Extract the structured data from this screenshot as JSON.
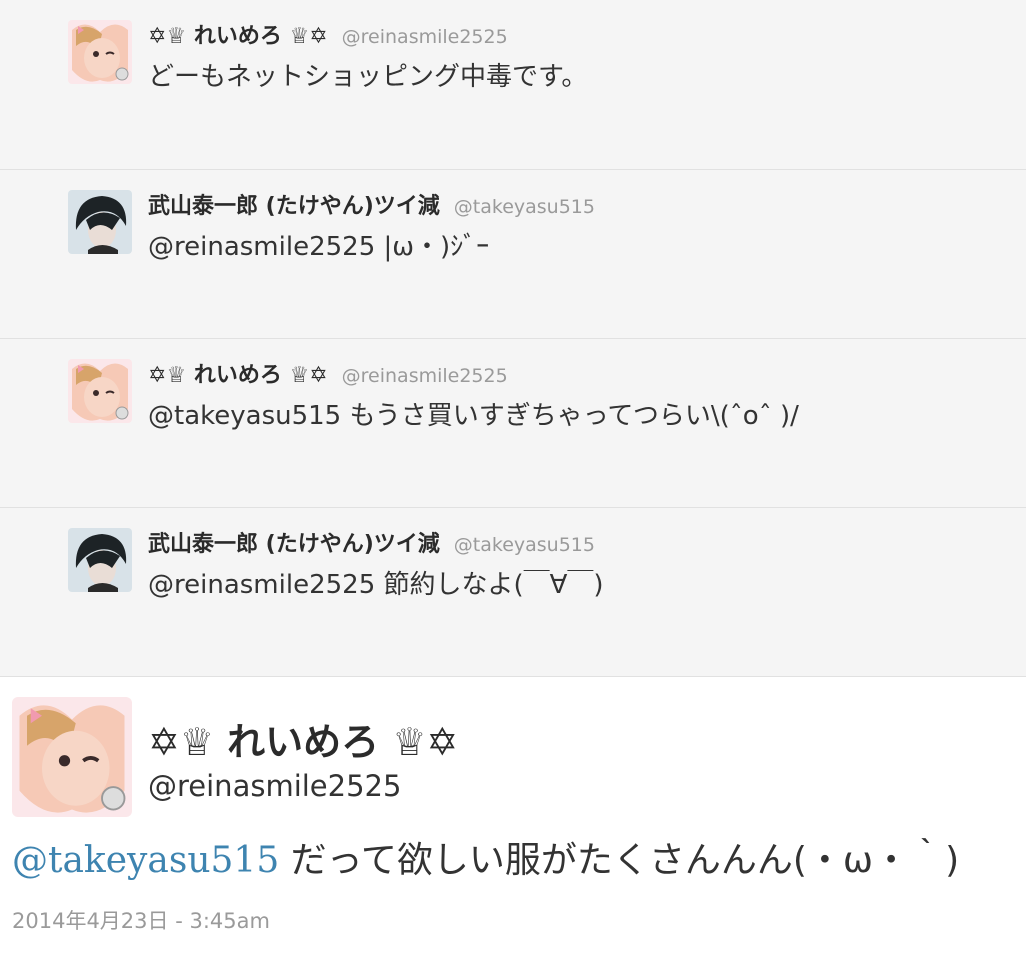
{
  "colors": {
    "reply_background": "#f5f5f5",
    "handle_gray": "#9a9a9a",
    "link_blue": "#3e84b0"
  },
  "replies": [
    {
      "avatar": "reina-avatar",
      "name": "✡♕ れいめろ ♕✡",
      "handle": "@reinasmile2525",
      "text": "どーもネットショッピング中毒です。"
    },
    {
      "avatar": "takeyasu-avatar",
      "name": "武山泰一郎 (たけやん)ツイ減",
      "handle": "@takeyasu515",
      "text": "@reinasmile2525 |ω・)ｼﾞｰ"
    },
    {
      "avatar": "reina-avatar",
      "name": "✡♕ れいめろ ♕✡",
      "handle": "@reinasmile2525",
      "text": "@takeyasu515 もうさ買いすぎちゃってつらい\\(ˆoˆ )/"
    },
    {
      "avatar": "takeyasu-avatar",
      "name": "武山泰一郎 (たけやん)ツイ減",
      "handle": "@takeyasu515",
      "text": "@reinasmile2525 節約しなよ(￣∀￣)"
    }
  ],
  "focus_tweet": {
    "avatar": "reina-avatar",
    "name": "✡♕ れいめろ ♕✡",
    "handle": "@reinasmile2525",
    "mention": "@takeyasu515",
    "body": " だって欲しい服がたくさんんん(・ω・｀)",
    "timestamp": "2014年4月23日 - 3:45am"
  }
}
